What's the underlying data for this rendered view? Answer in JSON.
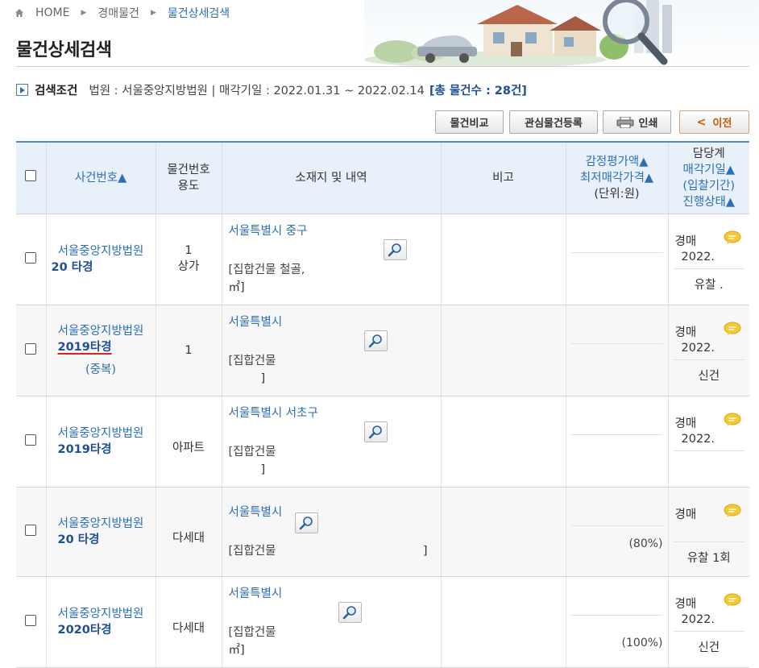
{
  "breadcrumb": {
    "home": "HOME",
    "level1": "경매물건",
    "current": "물건상세검색"
  },
  "page_title": "물건상세검색",
  "search": {
    "label": "검색조건",
    "text": "법원 : 서울중앙지방법원 | 매각기일 : 2022.01.31 ~ 2022.02.14",
    "total": "[총 물건수 : 28건]"
  },
  "toolbar": {
    "compare": "물건비교",
    "interest": "관심물건등록",
    "print": "인쇄",
    "prev": "이전"
  },
  "table": {
    "headers": {
      "case": "사건번호▲",
      "item_line1": "물건번호",
      "item_line2": "용도",
      "location": "소재지 및 내역",
      "note": "비고",
      "price_line1": "감정평가액▲",
      "price_line2": "최저매각가격▲",
      "price_line3": "(단위:원)",
      "status_line1": "담당계",
      "status_line2": "매각기일▲",
      "status_line3": "(입찰기간)",
      "status_line4": "진행상태▲"
    },
    "rows": [
      {
        "court": "서울중앙지방법원",
        "case_no": "20    타경",
        "dup": "",
        "item_no": "1",
        "use": "상가",
        "address": "서울특별시 중구",
        "detail": "[집합건물 철골,",
        "detail2": "㎡]",
        "rate": "",
        "dept": "경매",
        "date": "2022.",
        "status": "유찰    ."
      },
      {
        "court": "서울중앙지방법원",
        "case_no": "2019타경",
        "dup": "(중복)",
        "item_no": "1",
        "use": "",
        "address": "서울특별시",
        "detail": "[집합건물",
        "detail2": "]",
        "rate": "",
        "dept": "경매",
        "date": "2022.",
        "status": "신건"
      },
      {
        "court": "서울중앙지방법원",
        "case_no": "2019타경",
        "dup": "",
        "item_no": "",
        "use": "아파트",
        "address": "서울특별시 서초구",
        "detail": "[집합건물",
        "detail2": "]",
        "rate": "",
        "dept": "경매",
        "date": "2022.",
        "status": ""
      },
      {
        "court": "서울중앙지방법원",
        "case_no": "20    타경",
        "dup": "",
        "item_no": "",
        "use": "다세대",
        "address": "서울특별시",
        "detail": "[집합건물",
        "detail2": "]",
        "rate": "(80%)",
        "dept": "경매",
        "date": "",
        "status": "유찰 1회"
      },
      {
        "court": "서울중앙지방법원",
        "case_no": "2020타경",
        "dup": "",
        "item_no": "",
        "use": "다세대",
        "address": "서울특별시",
        "detail": "[집합건물",
        "detail2": "㎡]",
        "rate": "(100%)",
        "dept": "경매",
        "date": "2022.",
        "status": "신건"
      }
    ]
  },
  "colors": {
    "link": "#2d6fb5",
    "accent": "#1f4f95",
    "header_bg": "#e8f0fa",
    "prev_text": "#d35400"
  }
}
